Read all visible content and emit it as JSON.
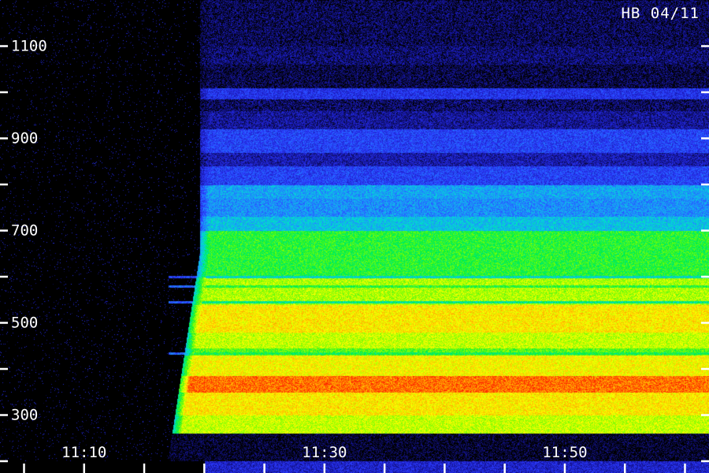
{
  "corner_label": "HB 04/11",
  "colors": {
    "background": "#000000",
    "axis": "#ffffff",
    "colormap": [
      "#000000",
      "#1818b0",
      "#2c3cff",
      "#1e90ff",
      "#00e0d0",
      "#00f040",
      "#8cff00",
      "#ffff00",
      "#ffa000",
      "#ff2000"
    ]
  },
  "chart_data": {
    "type": "heatmap",
    "title": "",
    "xlabel": "",
    "ylabel": "",
    "x_ticks": [
      "11:10",
      "11:30",
      "11:50"
    ],
    "y_ticks_labeled": [
      300,
      500,
      700,
      900,
      1100
    ],
    "y_ticks_unlabeled": [
      200,
      400,
      600,
      800,
      1000
    ],
    "ylim": [
      200,
      1200
    ],
    "x_range_minutes": [
      "11:03",
      "12:02"
    ],
    "signal_onset": "11:20",
    "intensity_scale": [
      0,
      1
    ],
    "bands": [
      {
        "y0": 260,
        "y1": 300,
        "intensity": 0.72
      },
      {
        "y0": 300,
        "y1": 350,
        "intensity": 0.8
      },
      {
        "y0": 350,
        "y1": 385,
        "intensity": 0.93
      },
      {
        "y0": 385,
        "y1": 430,
        "intensity": 0.78
      },
      {
        "y0": 430,
        "y1": 445,
        "intensity": 0.62
      },
      {
        "y0": 445,
        "y1": 480,
        "intensity": 0.72
      },
      {
        "y0": 480,
        "y1": 540,
        "intensity": 0.8
      },
      {
        "y0": 540,
        "y1": 600,
        "intensity": 0.7
      },
      {
        "y0": 600,
        "y1": 700,
        "intensity": 0.58
      },
      {
        "y0": 700,
        "y1": 730,
        "intensity": 0.4
      },
      {
        "y0": 730,
        "y1": 770,
        "intensity": 0.33
      },
      {
        "y0": 770,
        "y1": 800,
        "intensity": 0.36
      },
      {
        "y0": 800,
        "y1": 840,
        "intensity": 0.22
      },
      {
        "y0": 840,
        "y1": 870,
        "intensity": 0.12
      },
      {
        "y0": 870,
        "y1": 920,
        "intensity": 0.22
      },
      {
        "y0": 920,
        "y1": 960,
        "intensity": 0.1
      },
      {
        "y0": 960,
        "y1": 985,
        "intensity": 0.06
      },
      {
        "y0": 985,
        "y1": 1010,
        "intensity": 0.19
      },
      {
        "y0": 1010,
        "y1": 1060,
        "intensity": 0.04
      },
      {
        "y0": 1060,
        "y1": 1100,
        "intensity": 0.07
      },
      {
        "y0": 1100,
        "y1": 1200,
        "intensity": 0.05
      }
    ],
    "lines": [
      {
        "y": 435,
        "intensity": 0.55
      },
      {
        "y": 545,
        "intensity": 0.5
      },
      {
        "y": 580,
        "intensity": 0.58
      },
      {
        "y": 600,
        "intensity": 0.45
      }
    ]
  }
}
